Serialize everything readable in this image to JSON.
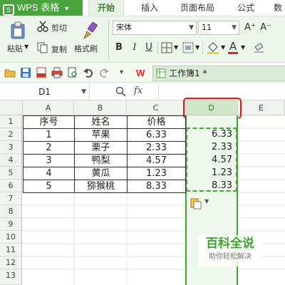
{
  "app": {
    "name": "WPS 表格",
    "icon": "app-logo-icon"
  },
  "tabs": [
    {
      "label": "开始",
      "active": true
    },
    {
      "label": "插入",
      "active": false
    },
    {
      "label": "页面布局",
      "active": false
    },
    {
      "label": "公式",
      "active": false
    },
    {
      "label": "数",
      "active": false
    }
  ],
  "ribbon": {
    "paste_label": "粘贴",
    "cut_label": "剪切",
    "copy_label": "复制",
    "format_painter_label": "格式刷",
    "font_name": "宋体",
    "font_size": "11",
    "bold": "B",
    "italic": "I",
    "underline": "U",
    "font_color_letter": "A",
    "grow_font": "A⁺",
    "shrink_font": "A⁻"
  },
  "document": {
    "tab_label": "工作簿1 *"
  },
  "formula_bar": {
    "name_box": "D1",
    "fx": "fx",
    "content": ""
  },
  "columns": [
    "A",
    "B",
    "C",
    "D",
    "E"
  ],
  "rows": [
    "1",
    "2",
    "3",
    "4",
    "5",
    "6",
    "7",
    "8",
    "9",
    "10",
    "11",
    "12",
    "13"
  ],
  "table": {
    "headers": [
      "序号",
      "姓名",
      "价格"
    ],
    "rows": [
      [
        "1",
        "苹果",
        "6.33"
      ],
      [
        "2",
        "栗子",
        "2.33"
      ],
      [
        "3",
        "鸭梨",
        "4.57"
      ],
      [
        "4",
        "黄瓜",
        "1.23"
      ],
      [
        "5",
        "猕猴桃",
        "8.33"
      ]
    ]
  },
  "column_d_values": [
    "6.33",
    "2.33",
    "4.57",
    "1.23",
    "8.33"
  ],
  "watermark": {
    "title": "百科全说",
    "subtitle": "助你轻松解决"
  },
  "colors": {
    "accent": "#4aa33f",
    "selection_border": "#3ea72d",
    "highlight_box": "#e01818",
    "ribbon_bg": "#eef5ec"
  }
}
